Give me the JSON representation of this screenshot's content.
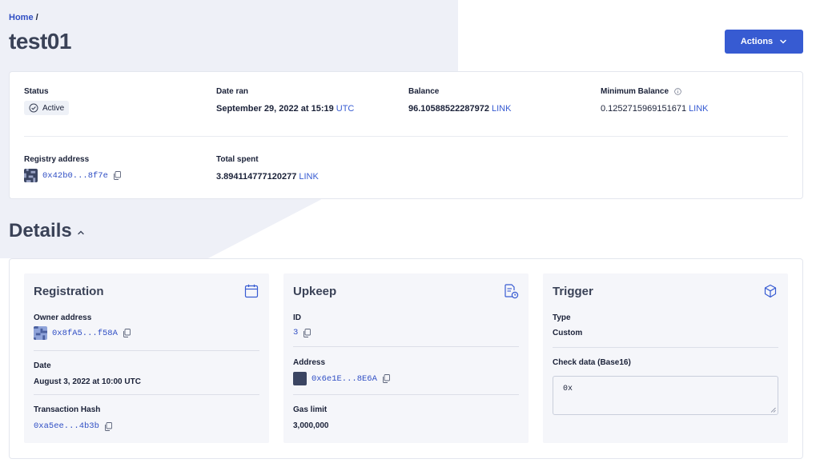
{
  "breadcrumb": {
    "home": "Home",
    "separator": "/"
  },
  "page": {
    "title": "test01"
  },
  "header": {
    "actions_label": "Actions"
  },
  "summary": {
    "status": {
      "label": "Status",
      "value": "Active"
    },
    "date_ran": {
      "label": "Date ran",
      "value": "September 29, 2022 at 15:19",
      "unit": "UTC"
    },
    "balance": {
      "label": "Balance",
      "value": "96.10588522287972",
      "unit": "LINK"
    },
    "min_balance": {
      "label": "Minimum Balance",
      "value": "0.1252715969151671",
      "unit": "LINK"
    },
    "registry": {
      "label": "Registry address",
      "value": "0x42b0...8f7e"
    },
    "total_spent": {
      "label": "Total spent",
      "value": "3.894114777120277",
      "unit": "LINK"
    }
  },
  "details": {
    "title": "Details",
    "registration": {
      "title": "Registration",
      "owner_label": "Owner address",
      "owner_value": "0x8fA5...f58A",
      "date_label": "Date",
      "date_value": "August 3, 2022 at 10:00 UTC",
      "tx_label": "Transaction Hash",
      "tx_value": "0xa5ee...4b3b"
    },
    "upkeep": {
      "title": "Upkeep",
      "id_label": "ID",
      "id_value": "3",
      "address_label": "Address",
      "address_value": "0x6e1E...8E6A",
      "gas_label": "Gas limit",
      "gas_value": "3,000,000"
    },
    "trigger": {
      "title": "Trigger",
      "type_label": "Type",
      "type_value": "Custom",
      "check_label": "Check data (Base16)",
      "check_value": "0x"
    }
  },
  "colors": {
    "accent": "#375bd2",
    "link": "#2f4ec4",
    "text": "#1a2138",
    "background_shape": "#eef0f7"
  },
  "icons": [
    "check-circle-icon",
    "info-icon",
    "copy-icon",
    "chevron-down-icon",
    "chevron-up-icon",
    "calendar-icon",
    "document-clock-icon",
    "cube-icon"
  ]
}
